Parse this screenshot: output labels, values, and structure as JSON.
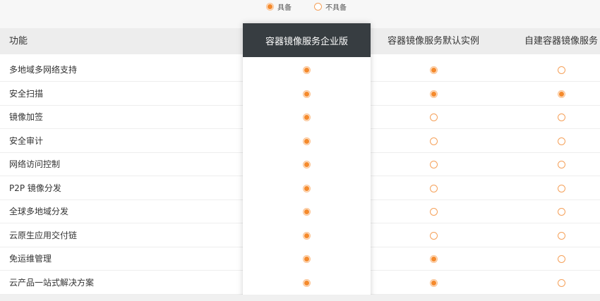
{
  "legend": {
    "available": "具备",
    "unavailable": "不具备"
  },
  "table": {
    "header": {
      "feature": "功能",
      "col1": "容器镜像服务企业版",
      "col2": "容器镜像服务默认实例",
      "col3": "自建容器镜像服务"
    },
    "rows": [
      {
        "label": "多地域多网络支持",
        "values": [
          true,
          true,
          false
        ]
      },
      {
        "label": "安全扫描",
        "values": [
          true,
          true,
          true
        ]
      },
      {
        "label": "镜像加签",
        "values": [
          true,
          false,
          false
        ]
      },
      {
        "label": "安全审计",
        "values": [
          true,
          false,
          false
        ]
      },
      {
        "label": "网络访问控制",
        "values": [
          true,
          false,
          false
        ]
      },
      {
        "label": "P2P 镜像分发",
        "values": [
          true,
          false,
          false
        ]
      },
      {
        "label": "全球多地域分发",
        "values": [
          true,
          false,
          false
        ]
      },
      {
        "label": "云原生应用交付链",
        "values": [
          true,
          false,
          false
        ]
      },
      {
        "label": "免运维管理",
        "values": [
          true,
          true,
          false
        ]
      },
      {
        "label": "云产品一站式解决方案",
        "values": [
          true,
          true,
          false
        ]
      }
    ]
  },
  "colors": {
    "accent": "#f58a2c",
    "featured_header_bg": "#373d41"
  }
}
